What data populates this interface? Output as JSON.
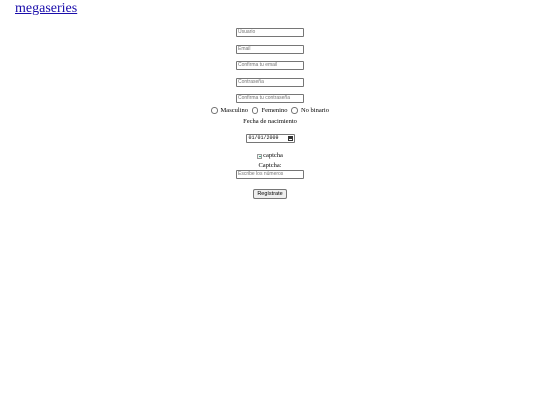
{
  "header": {
    "logo_text": "megaseries"
  },
  "form": {
    "username": {
      "placeholder": "Usuario",
      "value": ""
    },
    "email": {
      "placeholder": "Email",
      "value": ""
    },
    "email_confirm": {
      "placeholder": "Confirma tu email",
      "value": ""
    },
    "password": {
      "placeholder": "Contraseña",
      "value": ""
    },
    "password_confirm": {
      "placeholder": "Confirma tu contraseña",
      "value": ""
    },
    "gender": {
      "options": [
        "Masculino",
        "Femenino",
        "No binario"
      ],
      "selected": null
    },
    "birth": {
      "label": "Fecha de nacimiento",
      "value": "01/01/2009"
    },
    "captcha": {
      "image_alt": "captcha",
      "label": "Captcha:",
      "placeholder": "Escribe los números",
      "value": ""
    },
    "submit_label": "Regístrate"
  },
  "colors": {
    "link": "#1a0dab",
    "border": "#767676",
    "placeholder": "#757575"
  }
}
